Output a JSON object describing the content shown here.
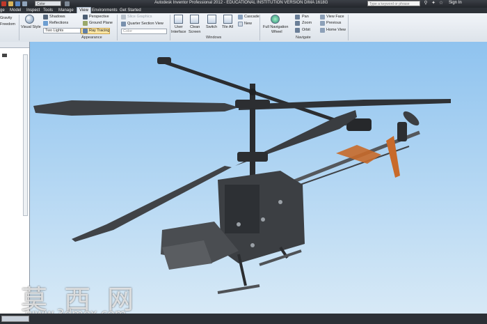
{
  "titlebar": {
    "title": "Autodesk Inventor Professional 2012 - EDUCATIONAL INSTITUTION VERSION    DIMA 1618G",
    "search_placeholder": "Type a keyword or phrase",
    "sign_in": "Sign In",
    "qat_combo": "Color"
  },
  "menu": {
    "items": [
      "ge",
      "Model",
      "Inspect",
      "Tools",
      "Manage",
      "View",
      "Environments",
      "Get Started"
    ],
    "active": "View"
  },
  "ribbon": {
    "visibility": {
      "gravity": "Gravity",
      "freedom": "Freedom"
    },
    "appearance": {
      "visual_style": "Visual Style",
      "shadows": "Shadows",
      "reflections": "Reflections",
      "lights": "Two Lights",
      "perspective": "Perspective",
      "ground_plane": "Ground Plane",
      "ray_tracing": "Ray Tracing",
      "label": "Appearance"
    },
    "middle": {
      "slice_graphics": "Slice Graphics",
      "quarter_section": "Quarter Section View",
      "color": "Color"
    },
    "windows": {
      "user_interface_1": "User",
      "user_interface_2": "Interface",
      "clean_screen_1": "Clean",
      "clean_screen_2": "Screen",
      "switch": "Switch",
      "tile_all": "Tile All",
      "cascade": "Cascade",
      "new": "New",
      "label": "Windows"
    },
    "navigate": {
      "full_nav_1": "Full Navigation",
      "full_nav_2": "Wheel",
      "pan": "Pan",
      "zoom": "Zoom",
      "orbit": "Orbit",
      "view_face": "View Face",
      "previous": "Previous",
      "home_view": "Home View",
      "label": "Navigate"
    }
  },
  "watermark": {
    "chinese": "莫 西 网",
    "url": "www.3dmox.com"
  },
  "colors": {
    "sky_top": "#8fc3ef",
    "sky_bottom": "#d7e9f6",
    "body_gray": "#3c3f43",
    "tail_orange": "#c86a2a"
  }
}
